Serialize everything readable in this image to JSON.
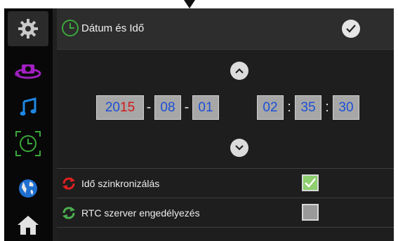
{
  "header": {
    "title": "Dátum és Idő"
  },
  "date": {
    "year_prefix": "20",
    "year_suffix": "15",
    "month": "08",
    "day": "01",
    "separator": "-"
  },
  "time": {
    "hour": "02",
    "minute": "35",
    "second": "30",
    "separator": ":"
  },
  "settings": [
    {
      "label": "Idő szinkronizálás",
      "checked": true
    },
    {
      "label": "RTC szerver engedélyezés",
      "checked": false
    }
  ],
  "sidebar": {
    "items": [
      {
        "icon": "gear-icon",
        "active": true
      },
      {
        "icon": "camera-rotate-icon",
        "active": false
      },
      {
        "icon": "music-note-icon",
        "active": false
      },
      {
        "icon": "clock-icon",
        "active": false
      },
      {
        "icon": "globe-icon",
        "active": false
      },
      {
        "icon": "home-icon",
        "active": false
      }
    ]
  },
  "colors": {
    "accent_green": "#8ecf6f",
    "field_text": "#1a4fd6",
    "year_highlight": "#d41818",
    "sync_icon": "#e02020",
    "rtc_icon": "#4caf50"
  }
}
